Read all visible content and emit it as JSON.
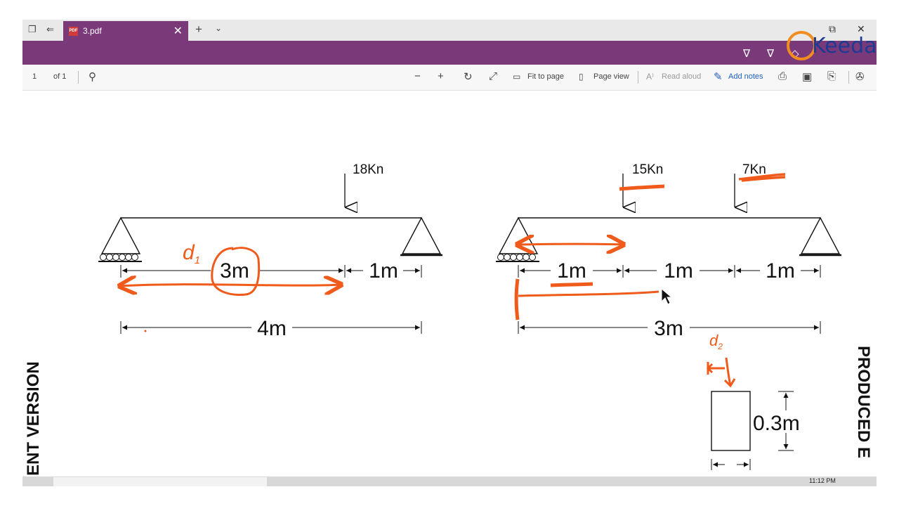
{
  "tab": {
    "title": "3.pdf",
    "pdf_badge": "PDF",
    "close": "✕"
  },
  "tabbar": {
    "new_tab": "+",
    "chevron": "⌄"
  },
  "window": {
    "restore": "⧉",
    "close": "✕"
  },
  "logo": {
    "word": "Keeda"
  },
  "toolbar": {
    "page_number": "1",
    "page_of": "of 1",
    "fit_to_page": "Fit to page",
    "page_view": "Page view",
    "read_aloud": "Read aloud",
    "add_notes": "Add notes"
  },
  "diagram": {
    "left_load": "18Kn",
    "left_span_a": "3m",
    "left_span_b": "1m",
    "left_total": "4m",
    "left_note": "d",
    "left_note_sub": "1",
    "right_load_a": "15Kn",
    "right_load_b": "7Kn",
    "right_span_a": "1m",
    "right_span_b": "1m",
    "right_span_c": "1m",
    "right_total": "3m",
    "right_note": "d",
    "right_note_sub": "2",
    "section_height": "0.3m"
  },
  "watermarks": {
    "left": "ENT VERSION",
    "right": "PRODUCED E"
  },
  "taskbar": {
    "clock": "11:12 PM"
  },
  "colors": {
    "accent": "#7a3a7a",
    "annotation": "#f05a1a",
    "logo_orange": "#f28c1f",
    "logo_blue": "#1f3a93"
  }
}
